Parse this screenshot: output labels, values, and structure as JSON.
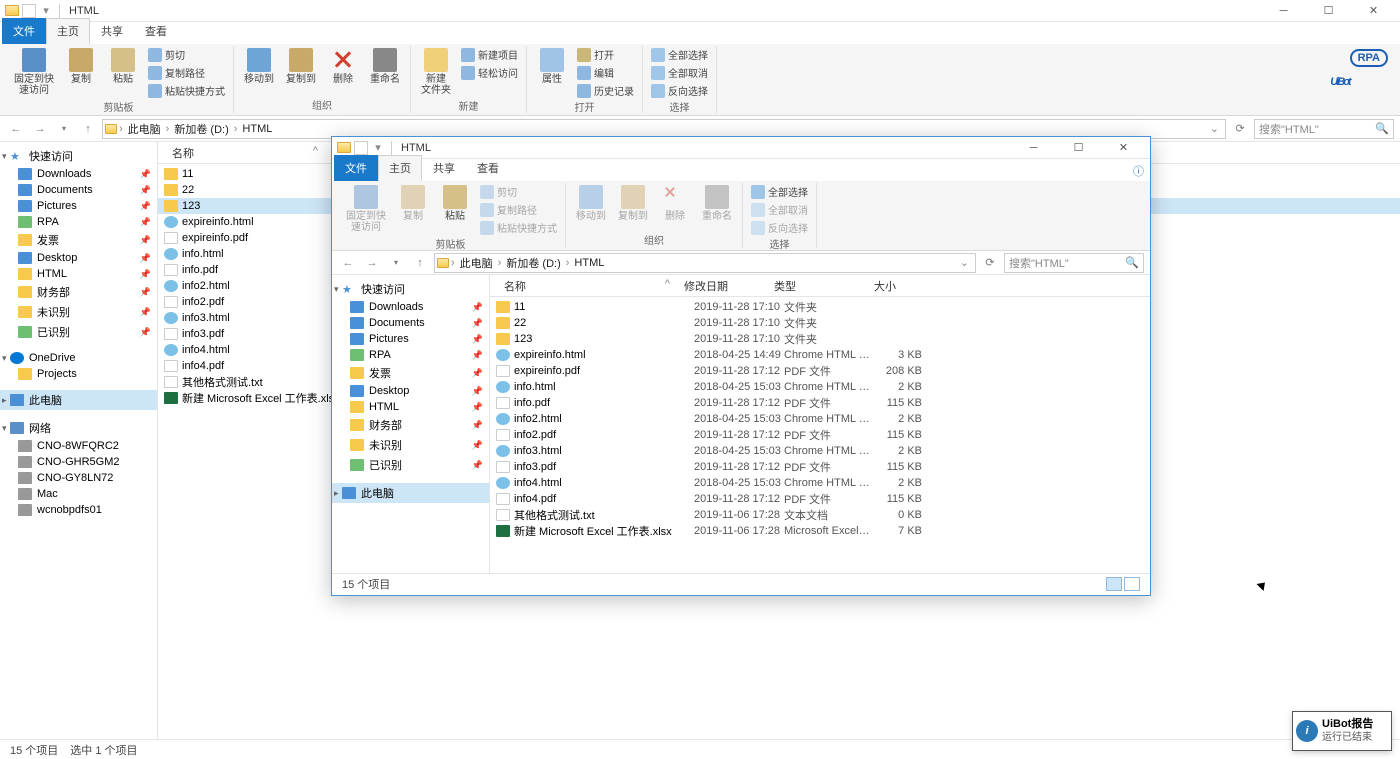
{
  "main_window": {
    "title": "HTML",
    "tabs": {
      "file": "文件",
      "home": "主页",
      "share": "共享",
      "view": "查看"
    },
    "ribbon": {
      "clipboard": {
        "pin": "固定到快\n速访问",
        "copy": "复制",
        "paste": "粘贴",
        "cut": "剪切",
        "copypath": "复制路径",
        "pasteshortcut": "粘贴快捷方式",
        "group": "剪贴板"
      },
      "organize": {
        "moveto": "移动到",
        "copyto": "复制到",
        "delete": "删除",
        "rename": "重命名",
        "group": "组织"
      },
      "new": {
        "newfolder": "新建\n文件夹",
        "newitem": "新建项目",
        "easyaccess": "轻松访问",
        "group": "新建"
      },
      "open": {
        "properties": "属性",
        "open": "打开",
        "edit": "编辑",
        "history": "历史记录",
        "group": "打开"
      },
      "select": {
        "selectall": "全部选择",
        "selectnone": "全部取消",
        "invert": "反向选择",
        "group": "选择"
      }
    },
    "breadcrumb": [
      "此电脑",
      "新加卷 (D:)",
      "HTML"
    ],
    "search_placeholder": "搜索\"HTML\"",
    "sidebar": {
      "quick": {
        "label": "快速访问",
        "items": [
          "Downloads",
          "Documents",
          "Pictures",
          "RPA",
          "发票",
          "Desktop",
          "HTML",
          "财务部",
          "未识别",
          "已识别"
        ]
      },
      "onedrive": {
        "label": "OneDrive",
        "items": [
          "Projects"
        ]
      },
      "thispc": {
        "label": "此电脑"
      },
      "network": {
        "label": "网络",
        "items": [
          "CNO-8WFQRC2",
          "CNO-GHR5GM2",
          "CNO-GY8LN72",
          "Mac",
          "wcnobpdfs01"
        ]
      }
    },
    "columns": {
      "name": "名称"
    },
    "files": [
      {
        "name": "11",
        "type": "folder"
      },
      {
        "name": "22",
        "type": "folder"
      },
      {
        "name": "123",
        "type": "folder",
        "sel": true
      },
      {
        "name": "expireinfo.html",
        "type": "html"
      },
      {
        "name": "expireinfo.pdf",
        "type": "pdf"
      },
      {
        "name": "info.html",
        "type": "html"
      },
      {
        "name": "info.pdf",
        "type": "pdf"
      },
      {
        "name": "info2.html",
        "type": "html"
      },
      {
        "name": "info2.pdf",
        "type": "pdf"
      },
      {
        "name": "info3.html",
        "type": "html"
      },
      {
        "name": "info3.pdf",
        "type": "pdf"
      },
      {
        "name": "info4.html",
        "type": "html"
      },
      {
        "name": "info4.pdf",
        "type": "pdf"
      },
      {
        "name": "其他格式测试.txt",
        "type": "txt"
      },
      {
        "name": "新建 Microsoft Excel 工作表.xlsx",
        "type": "xlsx"
      }
    ],
    "status": {
      "count": "15 个项目",
      "selected": "选中 1 个项目"
    }
  },
  "logo": {
    "text": "UiBot",
    "badge": "RPA"
  },
  "second_window": {
    "title": "HTML",
    "tabs": {
      "file": "文件",
      "home": "主页",
      "share": "共享",
      "view": "查看"
    },
    "breadcrumb": [
      "此电脑",
      "新加卷 (D:)",
      "HTML"
    ],
    "search_placeholder": "搜索\"HTML\"",
    "sidebar": {
      "quick": {
        "label": "快速访问",
        "items": [
          "Downloads",
          "Documents",
          "Pictures",
          "RPA",
          "发票",
          "Desktop",
          "HTML",
          "财务部",
          "未识别",
          "已识别"
        ]
      },
      "thispc": {
        "label": "此电脑"
      }
    },
    "columns": {
      "name": "名称",
      "date": "修改日期",
      "type": "类型",
      "size": "大小"
    },
    "files": [
      {
        "name": "11",
        "date": "2019-11-28 17:10",
        "type": "文件夹",
        "size": "",
        "ic": "folder"
      },
      {
        "name": "22",
        "date": "2019-11-28 17:10",
        "type": "文件夹",
        "size": "",
        "ic": "folder"
      },
      {
        "name": "123",
        "date": "2019-11-28 17:10",
        "type": "文件夹",
        "size": "",
        "ic": "folder"
      },
      {
        "name": "expireinfo.html",
        "date": "2018-04-25 14:49",
        "type": "Chrome HTML D...",
        "size": "3 KB",
        "ic": "html"
      },
      {
        "name": "expireinfo.pdf",
        "date": "2019-11-28 17:12",
        "type": "PDF 文件",
        "size": "208 KB",
        "ic": "pdf"
      },
      {
        "name": "info.html",
        "date": "2018-04-25 15:03",
        "type": "Chrome HTML D...",
        "size": "2 KB",
        "ic": "html"
      },
      {
        "name": "info.pdf",
        "date": "2019-11-28 17:12",
        "type": "PDF 文件",
        "size": "115 KB",
        "ic": "pdf"
      },
      {
        "name": "info2.html",
        "date": "2018-04-25 15:03",
        "type": "Chrome HTML D...",
        "size": "2 KB",
        "ic": "html"
      },
      {
        "name": "info2.pdf",
        "date": "2019-11-28 17:12",
        "type": "PDF 文件",
        "size": "115 KB",
        "ic": "pdf"
      },
      {
        "name": "info3.html",
        "date": "2018-04-25 15:03",
        "type": "Chrome HTML D...",
        "size": "2 KB",
        "ic": "html"
      },
      {
        "name": "info3.pdf",
        "date": "2019-11-28 17:12",
        "type": "PDF 文件",
        "size": "115 KB",
        "ic": "pdf"
      },
      {
        "name": "info4.html",
        "date": "2018-04-25 15:03",
        "type": "Chrome HTML D...",
        "size": "2 KB",
        "ic": "html"
      },
      {
        "name": "info4.pdf",
        "date": "2019-11-28 17:12",
        "type": "PDF 文件",
        "size": "115 KB",
        "ic": "pdf"
      },
      {
        "name": "其他格式测试.txt",
        "date": "2019-11-06 17:28",
        "type": "文本文档",
        "size": "0 KB",
        "ic": "txt"
      },
      {
        "name": "新建 Microsoft Excel 工作表.xlsx",
        "date": "2019-11-06 17:28",
        "type": "Microsoft Excel ...",
        "size": "7 KB",
        "ic": "xlsx"
      }
    ],
    "status": {
      "count": "15 个项目"
    }
  },
  "notify": {
    "title": "UiBot报告",
    "sub": "运行已结束"
  }
}
